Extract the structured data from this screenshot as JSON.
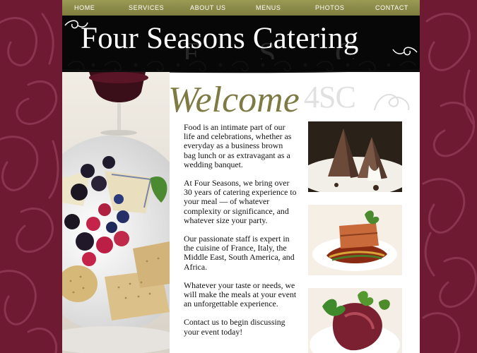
{
  "nav": {
    "items": [
      {
        "label": "HOME"
      },
      {
        "label": "SERVICES"
      },
      {
        "label": "ABOUT US"
      },
      {
        "label": "MENUS"
      },
      {
        "label": "PHOTOS"
      },
      {
        "label": "CONTACT"
      }
    ]
  },
  "header": {
    "title": "Four Seasons Catering",
    "ghost_letters": [
      "F",
      "S",
      "C"
    ]
  },
  "content": {
    "welcome": "Welcome",
    "monogram": "4SC",
    "paragraphs": [
      "Food is an intimate part of our life and celebrations, whether as everyday as a business brown bag lunch or as extravagant as a wedding banquet.",
      "At Four Seasons, we bring over 30 years of catering experience to your meal — of whatever complexity or significance, and whatever size your party.",
      "Our passionate staff is expert in the cuisine of France, Italy, the Middle East, South America, and Africa.",
      "Whatever your taste or needs, we will make the meals at your event an unforgettable experience.",
      "Contact us to begin discussing your event today!"
    ]
  },
  "colors": {
    "background": "#6e1a33",
    "nav": "#8a8a4a",
    "header": "#070707",
    "accent": "#7e7a43"
  },
  "icons": [
    "damask-pattern",
    "scroll-ornament",
    "swirl-flourish"
  ]
}
